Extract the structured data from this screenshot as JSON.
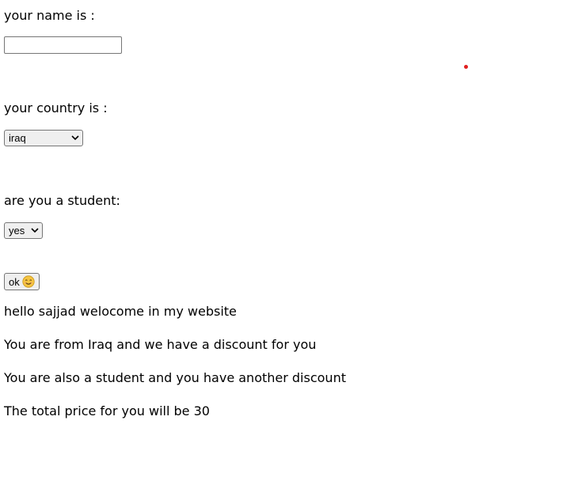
{
  "form": {
    "name_label": "your name is :",
    "name_value": "",
    "country_label": "your country is :",
    "country_selected": "iraq",
    "student_label": "are you a student:",
    "student_selected": "yes",
    "ok_button_label": "ok",
    "ok_button_icon": "smiling-face-emoji"
  },
  "messages": [
    "hello sajjad welocome in my website",
    "You are from Iraq and we have a discount for you",
    "You are also a student and you have another discount",
    "The total price for you will be 30"
  ],
  "colors": {
    "marker_dot": "#e02020",
    "control_border": "#767676",
    "control_bg": "#efefef",
    "emoji_face": "#f5c542"
  }
}
